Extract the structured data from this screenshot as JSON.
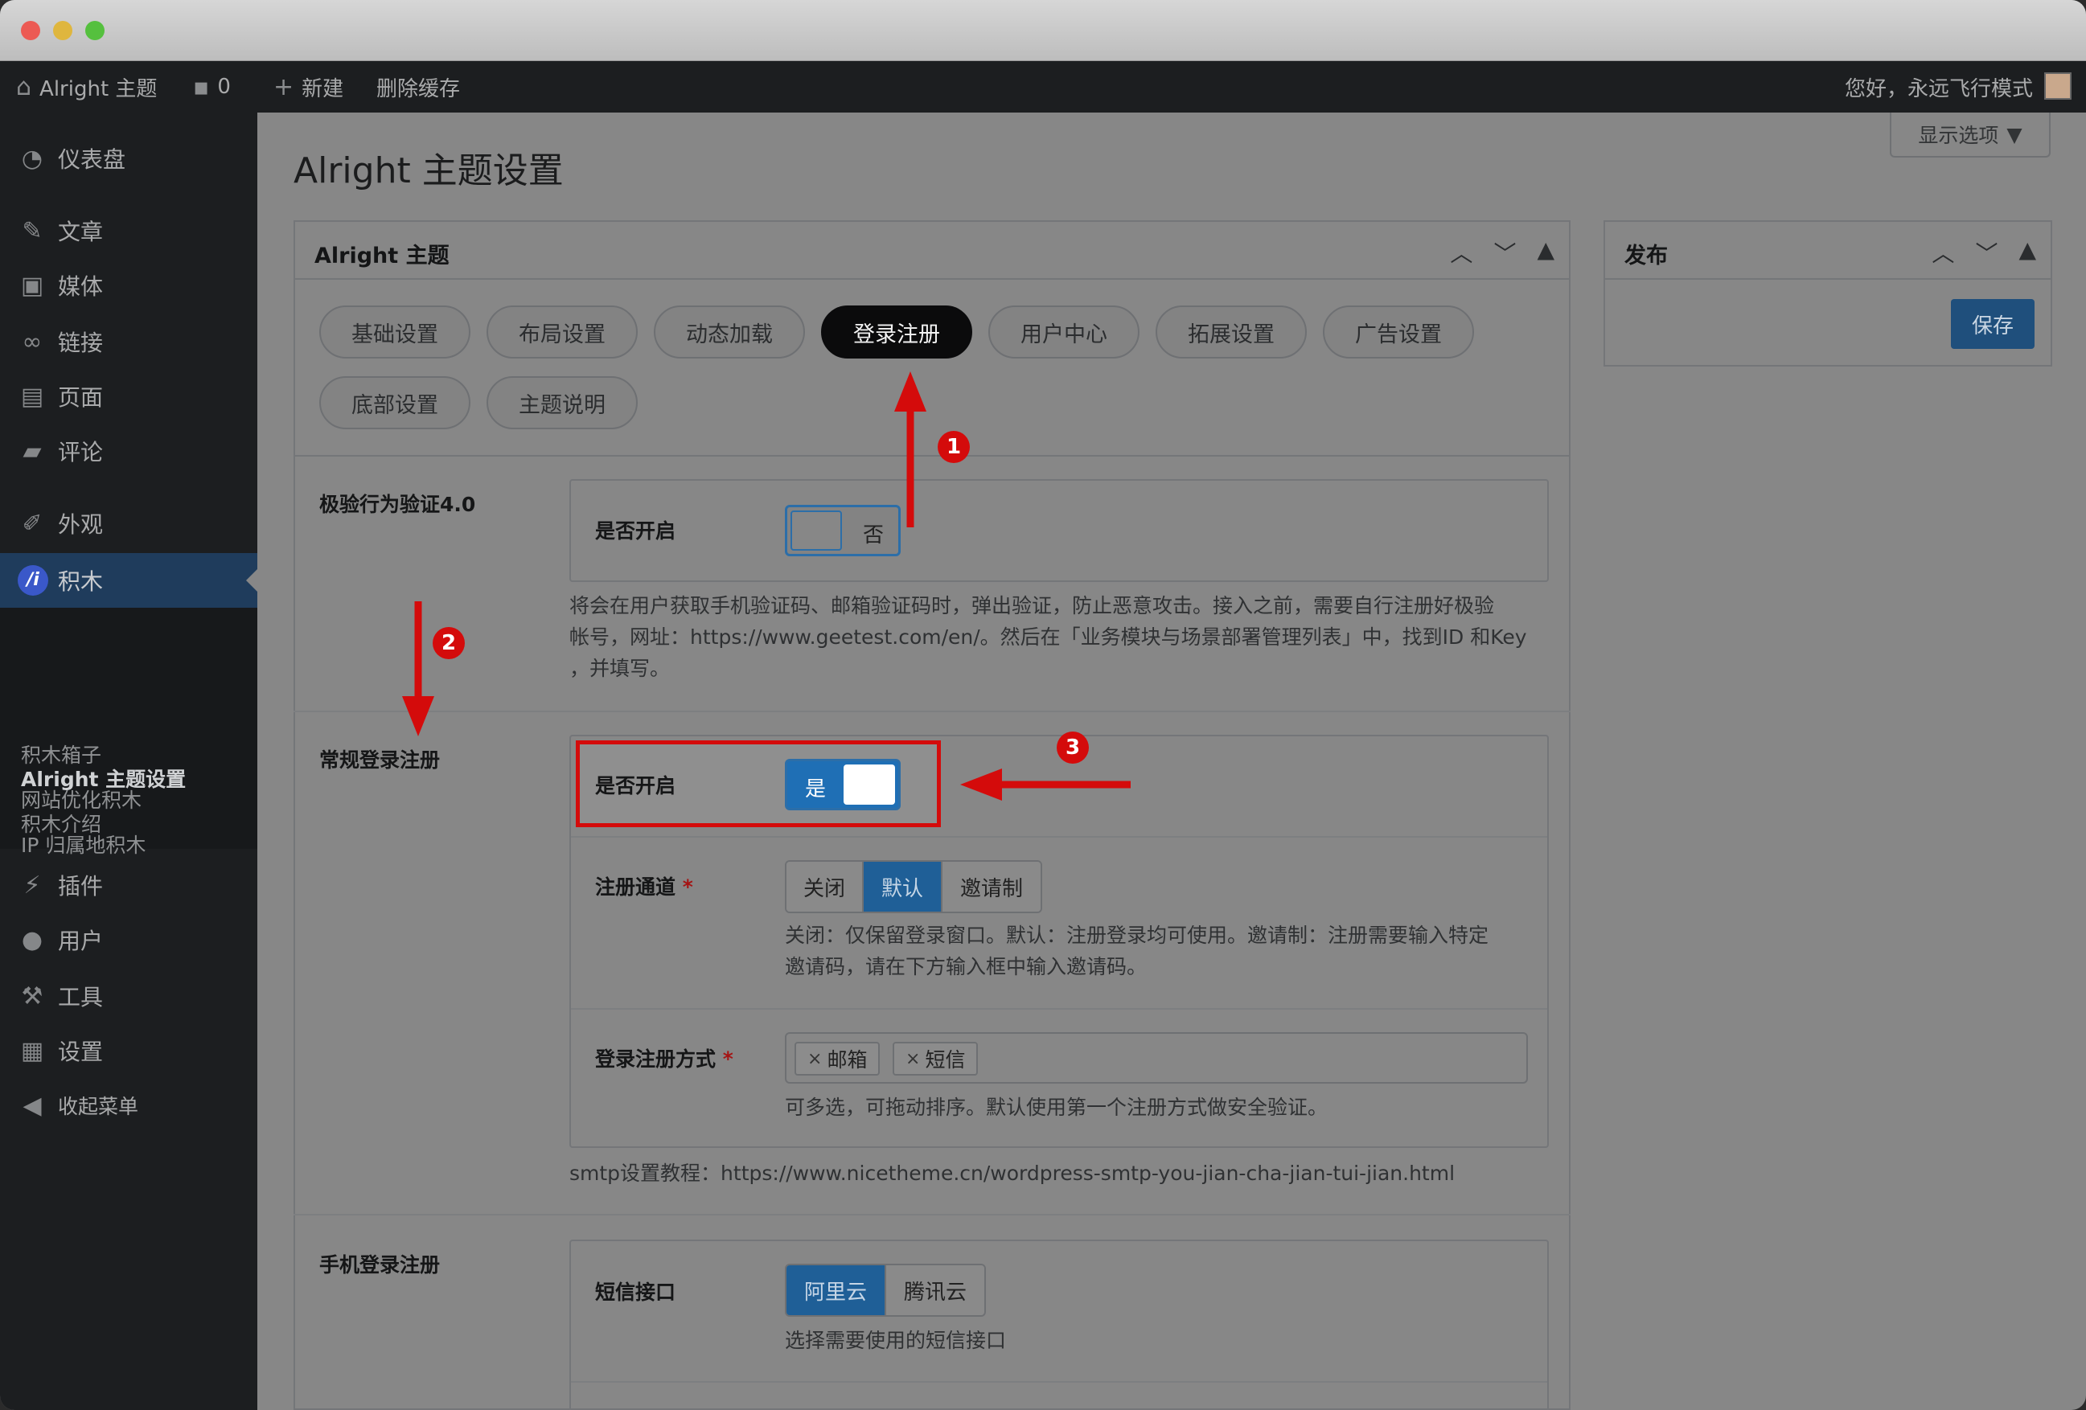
{
  "adminbar": {
    "site_name": "Alright 主题",
    "comment_count": "0",
    "new_label": "新建",
    "clear_cache_label": "删除缓存",
    "greeting": "您好，永远飞行模式"
  },
  "sidebar": {
    "items": [
      {
        "label": "仪表盘",
        "icon": "dashboard-icon"
      },
      {
        "label": "文章",
        "icon": "pin-icon"
      },
      {
        "label": "媒体",
        "icon": "media-icon"
      },
      {
        "label": "链接",
        "icon": "link-icon"
      },
      {
        "label": "页面",
        "icon": "page-icon"
      },
      {
        "label": "评论",
        "icon": "comment-icon"
      },
      {
        "label": "外观",
        "icon": "brush-icon"
      },
      {
        "label": "积木",
        "icon": "jimu-icon",
        "icon_text": "/i"
      },
      {
        "label": "插件",
        "icon": "plugin-icon"
      },
      {
        "label": "用户",
        "icon": "user-icon"
      },
      {
        "label": "工具",
        "icon": "wrench-icon"
      },
      {
        "label": "设置",
        "icon": "settings-icon"
      },
      {
        "label": "收起菜单",
        "icon": "collapse-icon"
      }
    ],
    "submenu": [
      "积木箱子",
      "网站优化积木",
      "IP 归属地积木",
      "Alright 主题设置",
      "积木介绍"
    ]
  },
  "page": {
    "title": "Alright 主题设置",
    "screen_options": "显示选项"
  },
  "panel": {
    "title": "Alright 主题",
    "tabs": [
      "基础设置",
      "布局设置",
      "动态加载",
      "登录注册",
      "用户中心",
      "拓展设置",
      "广告设置",
      "底部设置",
      "主题说明"
    ],
    "active_tab": "登录注册"
  },
  "geetest": {
    "section_label": "极验行为验证4.0",
    "enable_label": "是否开启",
    "toggle_text": "否",
    "desc_line1": "将会在用户获取手机验证码、邮箱验证码时，弹出验证，防止恶意攻击。接入之前，需要自行注册好极验",
    "desc_line2": "帐号，网址：https://www.geetest.com/en/。然后在「业务模块与场景部署管理列表」中，找到ID 和Key",
    "desc_line3": "，并填写。"
  },
  "regular_login": {
    "section_label": "常规登录注册",
    "enable_label": "是否开启",
    "toggle_text": "是",
    "channel_label": "注册通道",
    "channel_options": [
      "关闭",
      "默认",
      "邀请制"
    ],
    "channel_selected": "默认",
    "channel_desc_line1": "关闭：仅保留登录窗口。默认：注册登录均可使用。邀请制：注册需要输入特定",
    "channel_desc_line2": "邀请码，请在下方输入框中输入邀请码。",
    "method_label": "登录注册方式",
    "method_tags": [
      "邮箱",
      "短信"
    ],
    "method_desc": "可多选，可拖动排序。默认使用第一个注册方式做安全验证。",
    "smtp_note": "smtp设置教程：https://www.nicetheme.cn/wordpress-smtp-you-jian-cha-jian-tui-jian.html",
    "required_mark": "*"
  },
  "mobile_login": {
    "section_label": "手机登录注册",
    "sms_label": "短信接口",
    "sms_options": [
      "阿里云",
      "腾讯云"
    ],
    "sms_selected": "阿里云",
    "sms_desc": "选择需要使用的短信接口"
  },
  "publish": {
    "title": "发布",
    "save_label": "保存"
  },
  "annotations": {
    "badge1": "1",
    "badge2": "2",
    "badge3": "3",
    "color": "#d40b0b"
  }
}
